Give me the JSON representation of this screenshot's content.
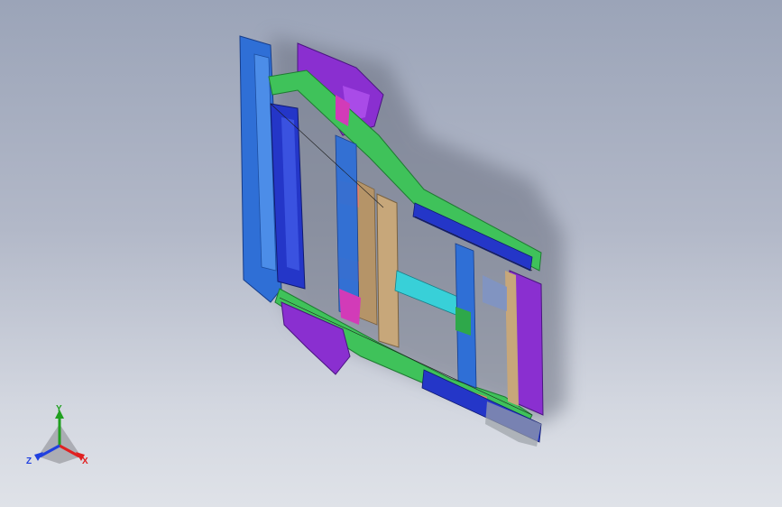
{
  "viewport": {
    "background_top": "#9ba4b8",
    "background_bottom": "#dfe2e8"
  },
  "model": {
    "colors": {
      "blue": "#2f6fd6",
      "dark_blue": "#2436c8",
      "purple": "#8a2fd0",
      "magenta": "#d23bb8",
      "green": "#3fc25a",
      "tan": "#c7a77a",
      "salmon": "#e0826a",
      "cyan": "#38d0d8",
      "grey": "#9da3a8",
      "shadow": "#6b7080"
    }
  },
  "triad": {
    "x_label": "X",
    "y_label": "Y",
    "z_label": "Z",
    "x_color": "#e02020",
    "y_color": "#20a020",
    "z_color": "#2040e0"
  }
}
